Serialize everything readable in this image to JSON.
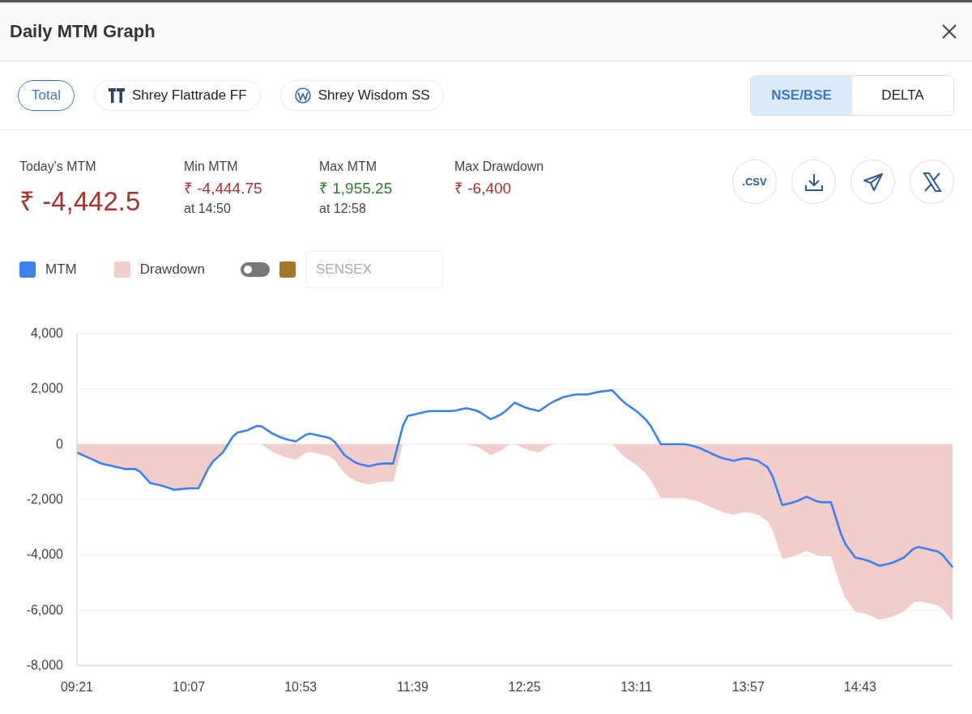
{
  "dialog": {
    "title": "Daily MTM Graph"
  },
  "accounts": [
    {
      "label": "Total",
      "kind": "total",
      "selected": true
    },
    {
      "label": "Shrey Flattrade FF",
      "kind": "flattrade",
      "selected": false
    },
    {
      "label": "Shrey Wisdom SS",
      "kind": "wisdom",
      "selected": false
    }
  ],
  "exchange_tabs": [
    {
      "label": "NSE/BSE",
      "selected": true
    },
    {
      "label": "DELTA",
      "selected": false
    }
  ],
  "stats": [
    {
      "kind": "headline",
      "label": "Today's MTM",
      "value": "₹ -4,442.5",
      "color": "#a8312e"
    },
    {
      "kind": "stat",
      "label": "Min MTM",
      "value": "₹ -4,444.75",
      "color": "#a8312e",
      "at": "at 14:50"
    },
    {
      "kind": "stat",
      "label": "Max MTM",
      "value": "₹ 1,955.25",
      "color": "#2e7d32",
      "at": "at 12:58"
    },
    {
      "kind": "stat",
      "label": "Max Drawdown",
      "value": "₹ -6,400",
      "color": "#a8312e"
    }
  ],
  "actions": [
    {
      "kind": "csv",
      "label": ".CSV"
    },
    {
      "kind": "download"
    },
    {
      "kind": "telegram"
    },
    {
      "kind": "x"
    }
  ],
  "index_overlay": {
    "on": false,
    "color": "#a4762a",
    "placeholder": "SENSEX"
  },
  "chart": {
    "chart_data": {
      "type": "line",
      "grid": true,
      "ylim": [
        -8000,
        4000
      ],
      "yticks": [
        {
          "value": 4000,
          "label": "4,000"
        },
        {
          "value": 2000,
          "label": "2,000"
        },
        {
          "value": 0,
          "label": "0"
        },
        {
          "value": -2000,
          "label": "-2,000"
        },
        {
          "value": -4000,
          "label": "-4,000"
        },
        {
          "value": -6000,
          "label": "-6,000"
        },
        {
          "value": -8000,
          "label": "-8,000"
        }
      ],
      "categories": [
        "09:21",
        null,
        null,
        null,
        null,
        null,
        null,
        null,
        null,
        null,
        null,
        null,
        null,
        null,
        null,
        null,
        null,
        null,
        null,
        null,
        null,
        null,
        null,
        "10:07",
        null,
        null,
        null,
        null,
        null,
        null,
        null,
        null,
        null,
        null,
        null,
        null,
        null,
        null,
        null,
        null,
        null,
        null,
        null,
        null,
        null,
        null,
        "10:53",
        null,
        null,
        null,
        null,
        null,
        null,
        null,
        null,
        null,
        null,
        null,
        null,
        null,
        null,
        null,
        null,
        null,
        null,
        null,
        null,
        null,
        null,
        "11:39",
        null,
        null,
        null,
        null,
        null,
        null,
        null,
        null,
        null,
        null,
        null,
        null,
        null,
        null,
        null,
        null,
        null,
        null,
        null,
        null,
        null,
        null,
        "12:25",
        null,
        null,
        null,
        null,
        null,
        null,
        null,
        null,
        null,
        null,
        null,
        null,
        null,
        null,
        null,
        null,
        null,
        null,
        null,
        null,
        null,
        null,
        "13:11",
        null,
        null,
        null,
        null,
        null,
        null,
        null,
        null,
        null,
        null,
        null,
        null,
        null,
        null,
        null,
        null,
        null,
        null,
        null,
        null,
        null,
        null,
        "13:57",
        null,
        null,
        null,
        null,
        null,
        null,
        null,
        null,
        null,
        null,
        null,
        null,
        null,
        null,
        null,
        null,
        null,
        null,
        null,
        null,
        null,
        null,
        "14:43",
        null,
        null,
        null,
        null,
        null,
        null,
        null,
        null,
        null,
        null,
        null,
        null,
        null,
        null,
        null,
        null,
        null,
        null,
        null
      ],
      "series": [
        {
          "name": "MTM",
          "type": "line",
          "color": "#3b82f0",
          "values": [
            -300,
            -380,
            -460,
            -540,
            -620,
            -700,
            -740,
            -780,
            -820,
            -860,
            -900,
            -900,
            -900,
            -1000,
            -1200,
            -1400,
            -1440,
            -1480,
            -1530,
            -1590,
            -1650,
            -1630,
            -1610,
            -1600,
            -1600,
            -1600,
            -1240,
            -880,
            -620,
            -460,
            -300,
            -20,
            260,
            420,
            460,
            500,
            580,
            660,
            640,
            520,
            400,
            320,
            240,
            180,
            140,
            100,
            220,
            340,
            380,
            340,
            300,
            260,
            220,
            80,
            -160,
            -400,
            -520,
            -640,
            -720,
            -760,
            -800,
            -760,
            -720,
            -700,
            -700,
            -700,
            -20,
            660,
            1020,
            1060,
            1100,
            1140,
            1180,
            1200,
            1200,
            1200,
            1200,
            1200,
            1220,
            1260,
            1300,
            1260,
            1220,
            1140,
            1020,
            900,
            980,
            1060,
            1180,
            1340,
            1500,
            1420,
            1340,
            1280,
            1240,
            1200,
            1320,
            1440,
            1540,
            1620,
            1700,
            1740,
            1780,
            1800,
            1800,
            1800,
            1840,
            1880,
            1910,
            1930,
            1950,
            1770,
            1590,
            1440,
            1320,
            1200,
            1040,
            880,
            640,
            320,
            0,
            0,
            0,
            0,
            0,
            0,
            -40,
            -80,
            -140,
            -220,
            -300,
            -380,
            -460,
            -520,
            -560,
            -600,
            -560,
            -520,
            -520,
            -560,
            -600,
            -720,
            -840,
            -1160,
            -1680,
            -2200,
            -2160,
            -2120,
            -2060,
            -1980,
            -1900,
            -1980,
            -2060,
            -2100,
            -2100,
            -2100,
            -2660,
            -3220,
            -3620,
            -3860,
            -4100,
            -4140,
            -4180,
            -4240,
            -4320,
            -4400,
            -4360,
            -4320,
            -4260,
            -4180,
            -4100,
            -3940,
            -3780,
            -3720,
            -3760,
            -3800,
            -3840,
            -3880,
            -4010,
            -4230,
            -4450
          ]
        },
        {
          "name": "Drawdown",
          "type": "area",
          "color": "#f3cccc",
          "values": [
            -300,
            -380,
            -460,
            -540,
            -620,
            -700,
            -740,
            -780,
            -820,
            -860,
            -900,
            -900,
            -900,
            -1000,
            -1200,
            -1400,
            -1440,
            -1480,
            -1530,
            -1590,
            -1650,
            -1630,
            -1610,
            -1600,
            -1600,
            -1600,
            -1240,
            -880,
            -620,
            -460,
            -300,
            -20,
            0,
            0,
            0,
            0,
            0,
            0,
            -20,
            -140,
            -260,
            -340,
            -420,
            -480,
            -520,
            -560,
            -440,
            -320,
            -280,
            -320,
            -360,
            -400,
            -440,
            -580,
            -820,
            -1060,
            -1180,
            -1300,
            -1380,
            -1420,
            -1460,
            -1420,
            -1380,
            -1360,
            -1360,
            -1360,
            -680,
            0,
            0,
            0,
            0,
            0,
            0,
            0,
            0,
            0,
            0,
            0,
            0,
            0,
            0,
            -40,
            -80,
            -160,
            -280,
            -400,
            -320,
            -240,
            -120,
            0,
            0,
            -80,
            -160,
            -220,
            -260,
            -300,
            -180,
            -60,
            0,
            0,
            0,
            0,
            0,
            0,
            0,
            0,
            0,
            0,
            0,
            0,
            0,
            -180,
            -360,
            -510,
            -630,
            -750,
            -910,
            -1070,
            -1310,
            -1630,
            -1950,
            -1950,
            -1950,
            -1950,
            -1950,
            -1950,
            -1990,
            -2030,
            -2090,
            -2170,
            -2250,
            -2330,
            -2410,
            -2470,
            -2510,
            -2550,
            -2510,
            -2470,
            -2470,
            -2510,
            -2550,
            -2670,
            -2790,
            -3110,
            -3630,
            -4150,
            -4110,
            -4070,
            -4010,
            -3930,
            -3850,
            -3930,
            -4010,
            -4050,
            -4050,
            -4050,
            -4610,
            -5170,
            -5570,
            -5810,
            -6050,
            -6090,
            -6130,
            -6190,
            -6270,
            -6350,
            -6310,
            -6270,
            -6210,
            -6130,
            -6050,
            -5890,
            -5730,
            -5670,
            -5710,
            -5750,
            -5790,
            -5830,
            -5960,
            -6180,
            -6400
          ]
        }
      ]
    }
  }
}
